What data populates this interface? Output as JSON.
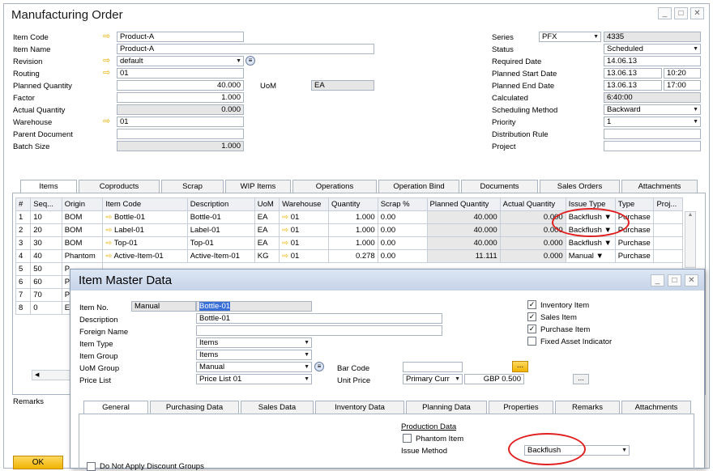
{
  "window": {
    "title": "Manufacturing Order"
  },
  "header_left": {
    "item_code": {
      "label": "Item Code",
      "value": "Product-A"
    },
    "item_name": {
      "label": "Item Name",
      "value": "Product-A"
    },
    "revision": {
      "label": "Revision",
      "value": "default"
    },
    "routing": {
      "label": "Routing",
      "value": "01"
    },
    "planned_qty": {
      "label": "Planned Quantity",
      "value": "40.000"
    },
    "uom": {
      "label": "UoM",
      "value": "EA"
    },
    "factor": {
      "label": "Factor",
      "value": "1.000"
    },
    "actual_qty": {
      "label": "Actual Quantity",
      "value": "0.000"
    },
    "warehouse": {
      "label": "Warehouse",
      "value": "01"
    },
    "parent_doc": {
      "label": "Parent Document",
      "value": ""
    },
    "batch_size": {
      "label": "Batch Size",
      "value": "1.000"
    }
  },
  "header_right": {
    "series": {
      "label": "Series",
      "value": "PFX",
      "number": "4335"
    },
    "status": {
      "label": "Status",
      "value": "Scheduled"
    },
    "required_date": {
      "label": "Required Date",
      "value": "14.06.13"
    },
    "start_date": {
      "label": "Planned Start Date",
      "value": "13.06.13",
      "time": "10:20"
    },
    "end_date": {
      "label": "Planned End Date",
      "value": "13.06.13",
      "time": "17:00"
    },
    "calculated": {
      "label": "Calculated",
      "value": "6:40:00"
    },
    "sched_method": {
      "label": "Scheduling Method",
      "value": "Backward"
    },
    "priority": {
      "label": "Priority",
      "value": "1"
    },
    "dist_rule": {
      "label": "Distribution Rule",
      "value": ""
    },
    "project": {
      "label": "Project",
      "value": ""
    }
  },
  "tabs": [
    "Items",
    "Coproducts",
    "Scrap",
    "WIP Items",
    "Operations",
    "Operation Bind",
    "Documents",
    "Sales Orders",
    "Attachments"
  ],
  "grid": {
    "headers": [
      "#",
      "Seq...",
      "Origin",
      "Item Code",
      "Description",
      "UoM",
      "Warehouse",
      "Quantity",
      "Scrap %",
      "Planned Quantity",
      "Actual Quantity",
      "Issue Type",
      "Type",
      "Proj..."
    ],
    "rows": [
      [
        "1",
        "10",
        "BOM",
        "Bottle-01",
        "Bottle-01",
        "EA",
        "01",
        "1.000",
        "0.00",
        "40.000",
        "0.000",
        "Backflush",
        "Purchase"
      ],
      [
        "2",
        "20",
        "BOM",
        "Label-01",
        "Label-01",
        "EA",
        "01",
        "1.000",
        "0.00",
        "40.000",
        "0.000",
        "Backflush",
        "Purchase"
      ],
      [
        "3",
        "30",
        "BOM",
        "Top-01",
        "Top-01",
        "EA",
        "01",
        "1.000",
        "0.00",
        "40.000",
        "0.000",
        "Backflush",
        "Purchase"
      ],
      [
        "4",
        "40",
        "Phantom",
        "Active-Item-01",
        "Active-Item-01",
        "KG",
        "01",
        "0.278",
        "0.00",
        "11.111",
        "0.000",
        "Manual",
        "Purchase"
      ],
      [
        "5",
        "50",
        "P"
      ],
      [
        "6",
        "60",
        "P"
      ],
      [
        "7",
        "70",
        "P"
      ],
      [
        "8",
        "0",
        "E"
      ]
    ]
  },
  "remarks_label": "Remarks",
  "ok_label": "OK",
  "dialog": {
    "title": "Item Master Data",
    "item_no": {
      "label": "Item No.",
      "mode": "Manual",
      "value": "Bottle-01"
    },
    "description": {
      "label": "Description",
      "value": "Bottle-01"
    },
    "foreign_name": {
      "label": "Foreign Name",
      "value": ""
    },
    "item_type": {
      "label": "Item Type",
      "value": "Items"
    },
    "item_group": {
      "label": "Item Group",
      "value": "Items"
    },
    "uom_group": {
      "label": "UoM Group",
      "value": "Manual"
    },
    "price_list": {
      "label": "Price List",
      "value": "Price List 01"
    },
    "bar_code": {
      "label": "Bar Code",
      "value": ""
    },
    "unit_price": {
      "label": "Unit Price",
      "currency": "Primary Curr",
      "value": "GBP 0.500"
    },
    "checks": [
      {
        "label": "Inventory Item",
        "checked": true
      },
      {
        "label": "Sales Item",
        "checked": true
      },
      {
        "label": "Purchase Item",
        "checked": true
      },
      {
        "label": "Fixed Asset Indicator",
        "checked": false
      }
    ],
    "tabs": [
      "General",
      "Purchasing Data",
      "Sales Data",
      "Inventory Data",
      "Planning Data",
      "Properties",
      "Remarks",
      "Attachments"
    ],
    "production_data": "Production Data",
    "phantom_item": "Phantom Item",
    "issue_method": {
      "label": "Issue Method",
      "value": "Backflush"
    },
    "no_discount": "Do Not Apply Discount Groups"
  }
}
